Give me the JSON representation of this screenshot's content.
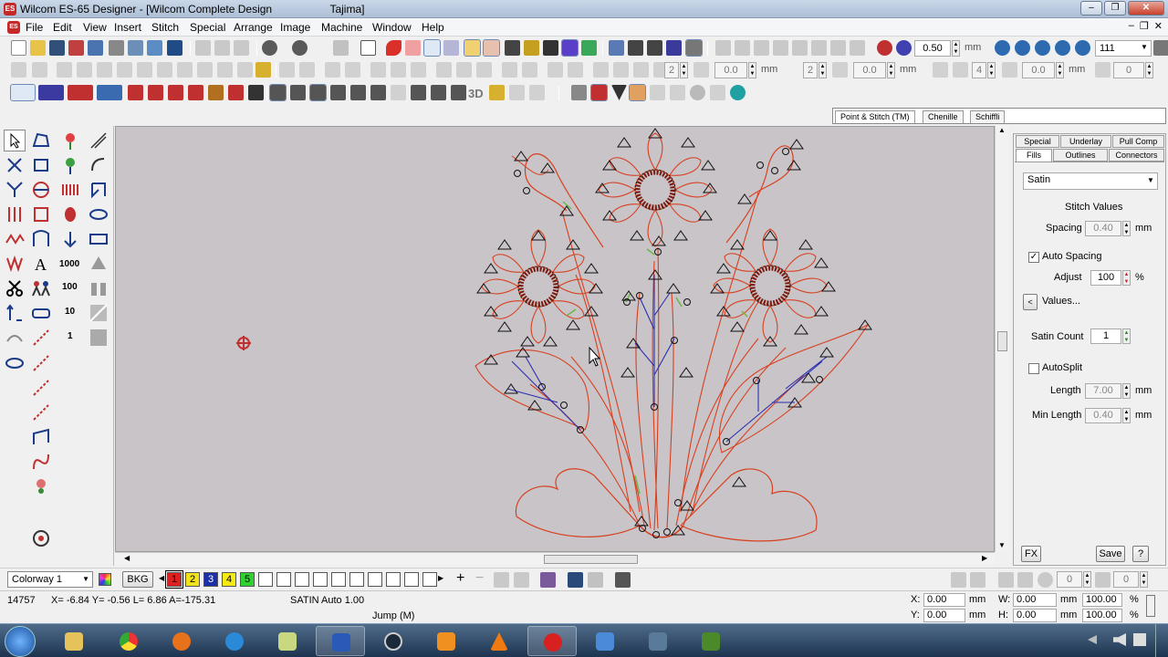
{
  "window": {
    "app_title": "Wilcom ES-65 Designer",
    "doc_title": "[Wilcom Complete Design",
    "machine": "Tajima]",
    "minimize_glyph": "–",
    "maximize_glyph": "❐",
    "close_glyph": "✕"
  },
  "menu": {
    "items": [
      "File",
      "Edit",
      "View",
      "Insert",
      "Stitch",
      "Special",
      "Arrange",
      "Image",
      "Machine",
      "Window",
      "Help"
    ],
    "mdi_glyphs": [
      "–",
      "❐",
      "✕"
    ]
  },
  "toolbar1": {
    "stitch_length": "0.50",
    "stitch_unit": "mm",
    "zoom": "111"
  },
  "toolbar2": {
    "fields": [
      "2",
      "0.0",
      "2",
      "0.0",
      "4",
      "0.0",
      "0"
    ],
    "unit": "mm"
  },
  "toolbar3": {
    "label_3d": "3D"
  },
  "object_tabs": [
    "Point & Stitch (TM)",
    "Chenille",
    "Schiffli"
  ],
  "toolbox": {
    "tools": [
      "select-object",
      "reshape",
      "lettering",
      "auto-fabric",
      "stitch-edit",
      "outline",
      "monogram",
      "arc",
      "knife",
      "branch",
      "column-a",
      "column-b",
      "run",
      "satin",
      "appliqué",
      "ellipse",
      "fill",
      "globe",
      "sequence",
      "rectangle",
      "tatami",
      "lettering-a",
      "number-1000",
      "cluster",
      "scissors",
      "people",
      "number-100",
      "binoculars",
      "shrink",
      "car",
      "number-10",
      "cut",
      "transform",
      "run-line",
      "number-1",
      "grid",
      "lasso",
      "backstitch",
      "manual",
      "line",
      "path",
      "polygon",
      "zigzag",
      "circle"
    ],
    "labels": {
      "n1000": "1000",
      "n100": "100",
      "n10": "10",
      "n1": "1",
      "letter_a": "A"
    }
  },
  "props": {
    "tabs_row1": [
      "Special",
      "Underlay",
      "Pull Comp"
    ],
    "tabs_row2": [
      "Fills",
      "Outlines",
      "Connectors"
    ],
    "fill_type": "Satin",
    "stitch_values_label": "Stitch Values",
    "spacing_label": "Spacing",
    "spacing_value": "0.40",
    "auto_spacing_label": "Auto Spacing",
    "auto_spacing_checked": true,
    "adjust_label": "Adjust",
    "adjust_value": "100",
    "adjust_unit": "%",
    "values_button": "Values...",
    "satin_count_label": "Satin Count",
    "satin_count_value": "1",
    "autosplit_label": "AutoSplit",
    "autosplit_checked": false,
    "length_label": "Length",
    "length_value": "7.00",
    "min_length_label": "Min Length",
    "min_length_value": "0.40",
    "unit_mm": "mm",
    "fx_button": "FX",
    "save_button": "Save",
    "help_button": "?"
  },
  "colorbar": {
    "colorway": "Colorway 1",
    "bkg_label": "BKG",
    "swatches": [
      {
        "label": "1",
        "color": "#e02020"
      },
      {
        "label": "2",
        "color": "#f2e21a"
      },
      {
        "label": "3",
        "color": "#1c2fa8"
      },
      {
        "label": "4",
        "color": "#f5eb12"
      },
      {
        "label": "5",
        "color": "#2fd02f"
      }
    ],
    "empty_slots": 10
  },
  "status": {
    "stitch_count": "14757",
    "coords": "X= -6.84 Y= -0.56 L= 6.86 A=-175.31",
    "stitch_type": "SATIN Auto 1.00",
    "jump": "Jump (M)",
    "x_label": "X:",
    "x_value": "0.00",
    "y_label": "Y:",
    "y_value": "0.00",
    "w_label": "W:",
    "w_value": "0.00",
    "h_label": "H:",
    "h_value": "0.00",
    "unit_mm": "mm",
    "w_pct": "100.00",
    "h_pct": "100.00",
    "pct": "%"
  },
  "taskbar": {
    "apps": [
      "start-orb",
      "explorer",
      "chrome",
      "firefox",
      "internet-explorer",
      "notepad",
      "outlook",
      "media-center",
      "media-player",
      "vlc",
      "wilcom",
      "paint",
      "itunes",
      "camtasia"
    ]
  },
  "colors": {
    "canvas_bg": "#c8c4c8",
    "outline_red": "#d8401f",
    "stitch_blue": "#2a2fb0",
    "accent_green": "#6ab84a"
  }
}
